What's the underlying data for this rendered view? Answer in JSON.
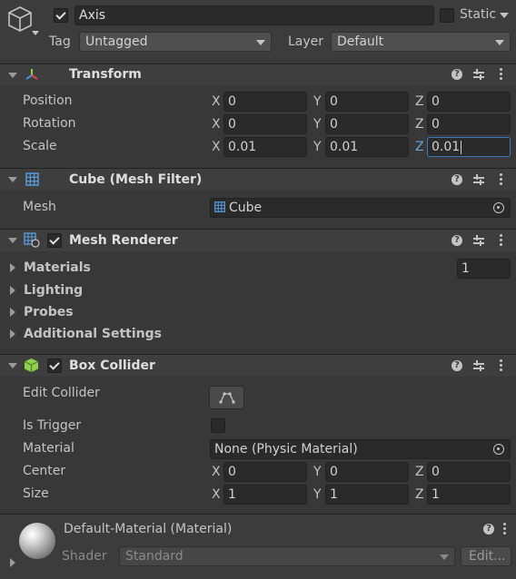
{
  "object": {
    "active": true,
    "name": "Axis",
    "static_label": "Static",
    "static_checked": false,
    "tag_label": "Tag",
    "tag_value": "Untagged",
    "layer_label": "Layer",
    "layer_value": "Default"
  },
  "transform": {
    "title": "Transform",
    "rows": [
      {
        "label": "Position",
        "x": "0",
        "y": "0",
        "z": "0"
      },
      {
        "label": "Rotation",
        "x": "0",
        "y": "0",
        "z": "0"
      },
      {
        "label": "Scale",
        "x": "0.01",
        "y": "0.01",
        "z": "0.01"
      }
    ],
    "axis_labels": {
      "x": "X",
      "y": "Y",
      "z": "Z"
    }
  },
  "mesh_filter": {
    "title": "Cube (Mesh Filter)",
    "mesh_label": "Mesh",
    "mesh_value": "Cube"
  },
  "mesh_renderer": {
    "title": "Mesh Renderer",
    "enabled": true,
    "sections": [
      "Materials",
      "Lighting",
      "Probes",
      "Additional Settings"
    ],
    "materials_count": "1"
  },
  "box_collider": {
    "title": "Box Collider",
    "enabled": true,
    "edit_collider_label": "Edit Collider",
    "is_trigger_label": "Is Trigger",
    "is_trigger": false,
    "material_label": "Material",
    "material_value": "None (Physic Material)",
    "center_label": "Center",
    "center": {
      "x": "0",
      "y": "0",
      "z": "0"
    },
    "size_label": "Size",
    "size": {
      "x": "1",
      "y": "1",
      "z": "1"
    }
  },
  "material": {
    "title": "Default-Material (Material)",
    "shader_label": "Shader",
    "shader_value": "Standard",
    "edit_label": "Edit..."
  },
  "colors": {
    "background": "#383838",
    "header": "#3e3e3e",
    "field": "#2a2a2a",
    "focus": "#3a79bb",
    "collider_green": "#8fd14f"
  }
}
